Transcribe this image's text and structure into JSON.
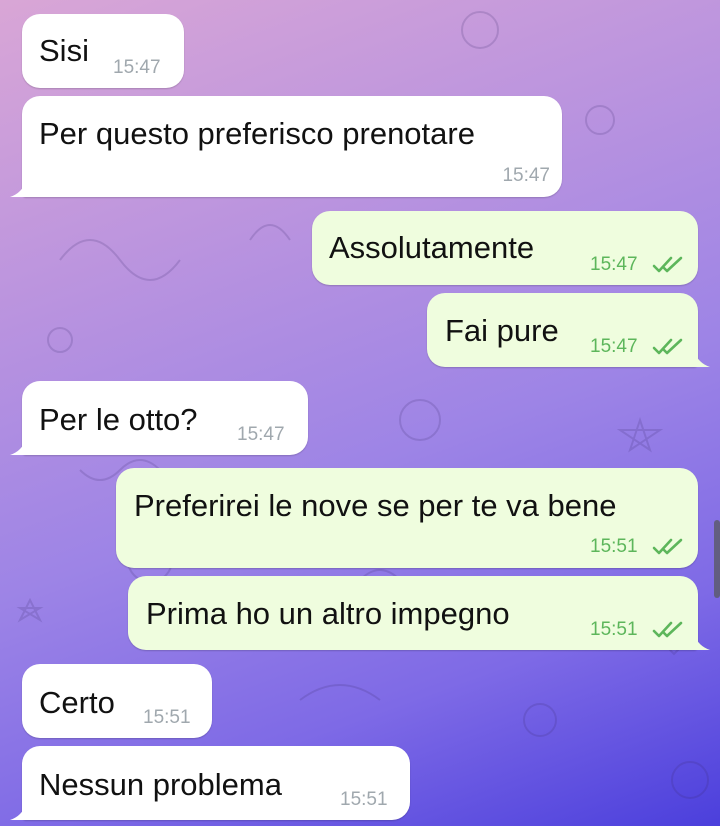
{
  "messages": [
    {
      "id": "m1",
      "dir": "in",
      "text": "Sisi",
      "time": "15:47"
    },
    {
      "id": "m2",
      "dir": "in",
      "text": "Per questo preferisco prenotare",
      "time": "15:47"
    },
    {
      "id": "m3",
      "dir": "out",
      "text": "Assolutamente",
      "time": "15:47",
      "status": "read"
    },
    {
      "id": "m4",
      "dir": "out",
      "text": "Fai pure",
      "time": "15:47",
      "status": "read"
    },
    {
      "id": "m5",
      "dir": "in",
      "text": "Per le otto?",
      "time": "15:47"
    },
    {
      "id": "m6",
      "dir": "out",
      "text": "Preferirei le nove se per te va bene",
      "time": "15:51",
      "status": "read"
    },
    {
      "id": "m7",
      "dir": "out",
      "text": "Prima ho un altro impegno",
      "time": "15:51",
      "status": "read"
    },
    {
      "id": "m8",
      "dir": "in",
      "text": "Certo",
      "time": "15:51"
    },
    {
      "id": "m9",
      "dir": "in",
      "text": "Nessun problema",
      "time": "15:51"
    }
  ],
  "colors": {
    "incoming_bubble": "#ffffff",
    "outgoing_bubble": "#effdde",
    "outgoing_time": "#5db65b",
    "incoming_time": "#a0a8ae"
  },
  "icons": {
    "read_status": "double-check-icon"
  }
}
